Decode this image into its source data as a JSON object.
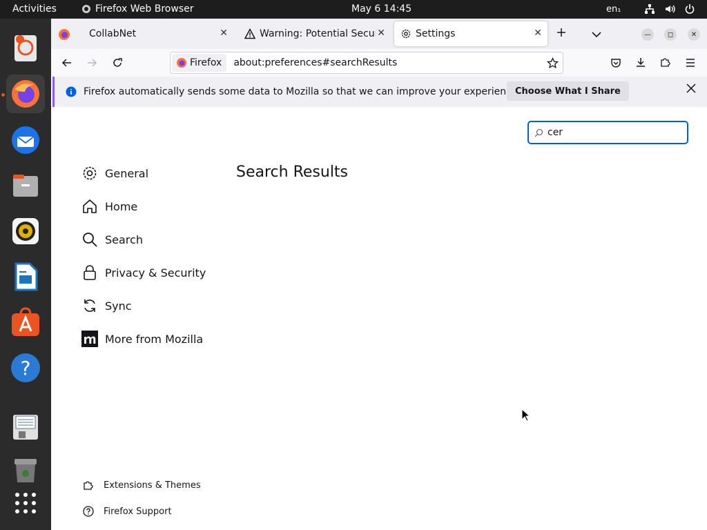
{
  "topbar": {
    "activities": "Activities",
    "app_name": "Firefox Web Browser",
    "clock": "May 6  14:45",
    "lang": "en₁"
  },
  "dock": {
    "items": [
      "ubuntu-help-icon",
      "firefox-icon",
      "thunderbird-icon",
      "files-icon",
      "rhythmbox-icon",
      "writer-icon",
      "app-center-icon",
      "help-icon",
      "save-icon",
      "trash-icon",
      "app-grid-icon"
    ]
  },
  "tabs": [
    {
      "label": "CollabNet"
    },
    {
      "label": "Warning: Potential Securi"
    },
    {
      "label": "Settings"
    }
  ],
  "nav": {
    "identity_label": "Firefox",
    "url": "about:preferences#searchResults"
  },
  "notification": {
    "message": "Firefox automatically sends some data to Mozilla so that we can improve your experience.",
    "choose_label": "Choose What I Share"
  },
  "settings": {
    "search_value": "cer",
    "page_title": "Search Results",
    "categories": [
      {
        "label": "General"
      },
      {
        "label": "Home"
      },
      {
        "label": "Search"
      },
      {
        "label": "Privacy & Security"
      },
      {
        "label": "Sync"
      },
      {
        "label": "More from Mozilla"
      }
    ],
    "footer": [
      {
        "label": "Extensions & Themes"
      },
      {
        "label": "Firefox Support"
      }
    ]
  },
  "colors": {
    "accent": "#0061e0",
    "ubuntu_orange": "#e95420",
    "notif_border": "#9059ff"
  }
}
